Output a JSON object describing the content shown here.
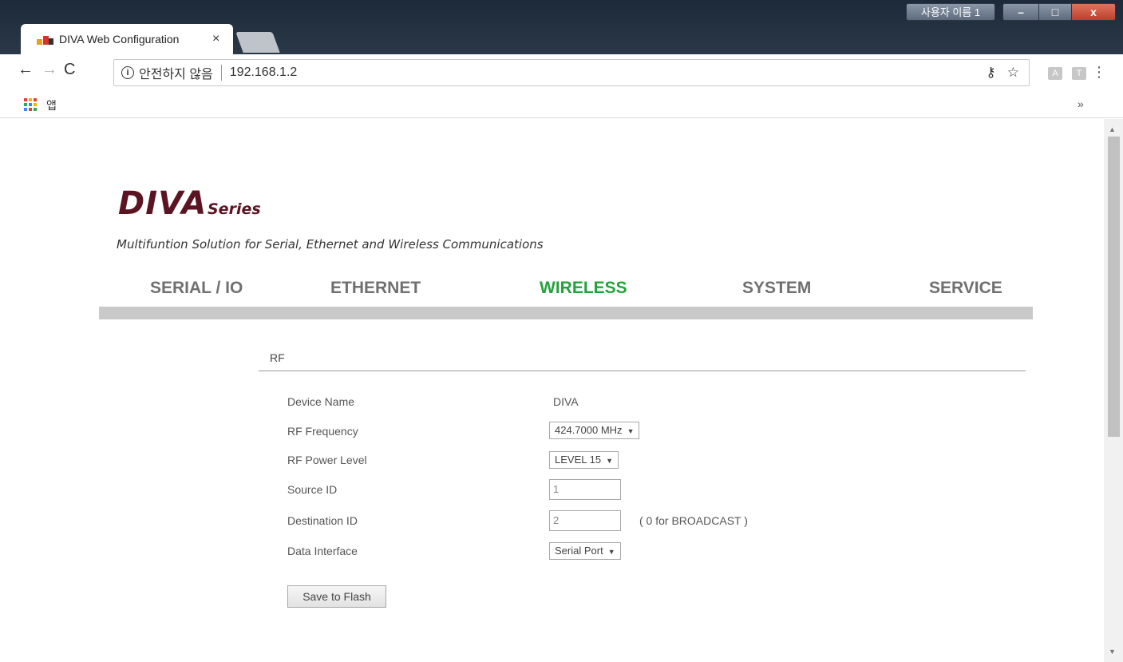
{
  "browser": {
    "tab_title": "DIVA Web Configuration",
    "tab_close": "×",
    "window_user": "사용자 이름 1",
    "window_min": "–",
    "window_max": "□",
    "window_close": "x",
    "security_label": "안전하지 않음",
    "url": "192.168.1.2",
    "bookmarks_apps": "앱",
    "bookmarks_more": "»"
  },
  "page": {
    "logo": "DIVA",
    "logo_series": "Series",
    "tagline": "Multifuntion Solution for Serial, Ethernet and Wireless Communications",
    "nav": [
      {
        "label": "SERIAL / IO"
      },
      {
        "label": "ETHERNET"
      },
      {
        "label": "WIRELESS",
        "active": true
      },
      {
        "label": "SYSTEM"
      },
      {
        "label": "SERVICE"
      }
    ],
    "section_title": "RF",
    "fields": {
      "device_name": {
        "label": "Device Name",
        "value": "DIVA"
      },
      "rf_frequency": {
        "label": "RF Frequency",
        "value": "424.7000 MHz"
      },
      "rf_power_level": {
        "label": "RF Power Level",
        "value": "LEVEL 15"
      },
      "source_id": {
        "label": "Source ID",
        "value": "1"
      },
      "destination_id": {
        "label": "Destination ID",
        "value": "2",
        "hint": "( 0 for BROADCAST )"
      },
      "data_interface": {
        "label": "Data Interface",
        "value": "Serial Port"
      }
    },
    "save_button": "Save to Flash"
  },
  "colors": {
    "active_nav": "#22a33a",
    "inactive_nav": "#707070",
    "logo": "#5b1422",
    "nav_bar": "#c9c9c9"
  }
}
